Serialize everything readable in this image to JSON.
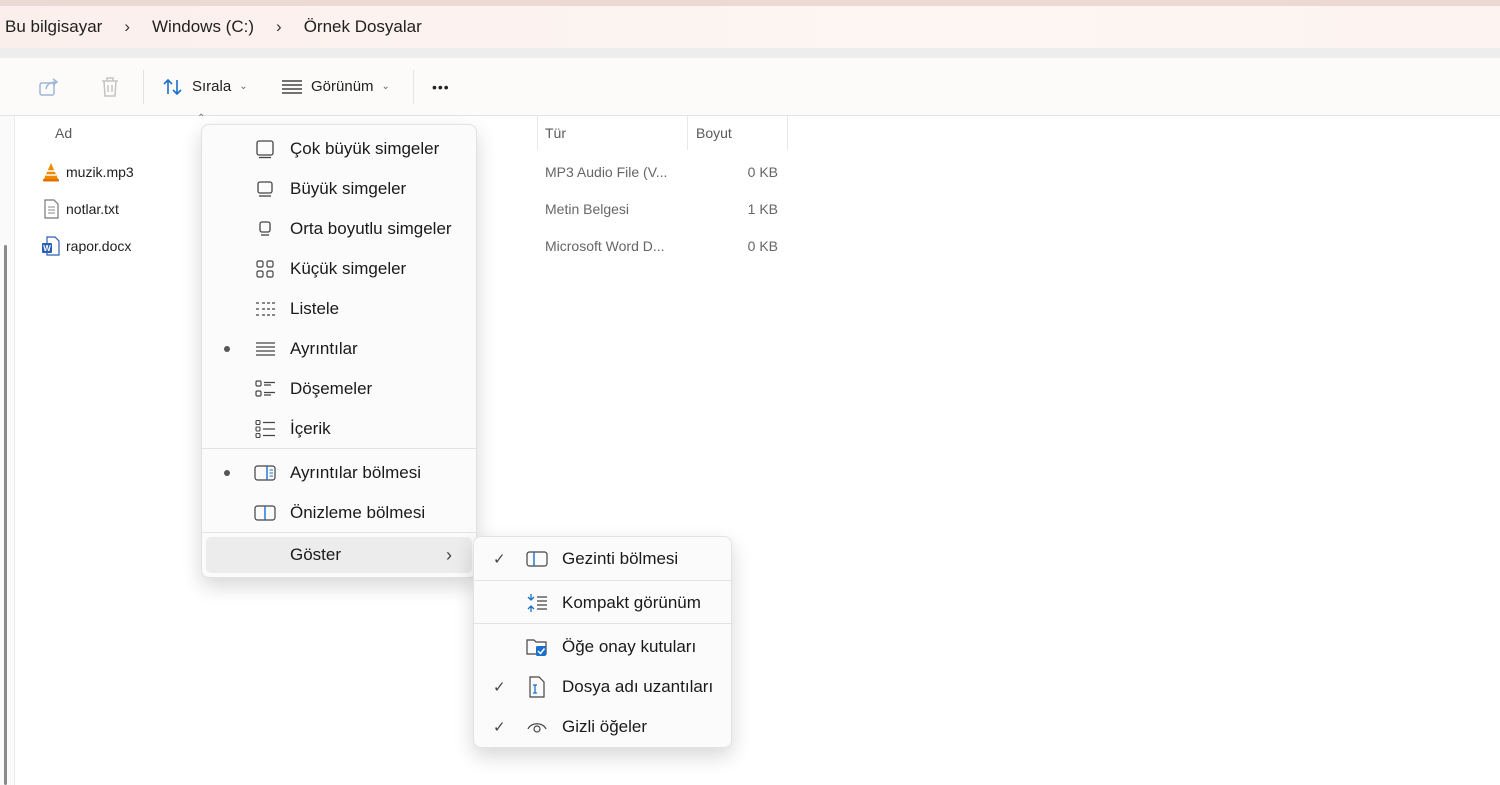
{
  "breadcrumb": [
    "Bu bilgisayar",
    "Windows (C:)",
    "Örnek Dosyalar"
  ],
  "breadcrumb_separator": "›",
  "toolbar": {
    "share_icon": "share-icon",
    "delete_icon": "trash-icon",
    "sort_label": "Sırala",
    "view_label": "Görünüm",
    "more_label": "•••"
  },
  "columns": {
    "name": "Ad",
    "type": "Tür",
    "size": "Boyut"
  },
  "files": [
    {
      "name": "muzik.mp3",
      "type": "MP3 Audio File (V...",
      "size": "0 KB",
      "icon": "vlc-icon"
    },
    {
      "name": "notlar.txt",
      "type": "Metin Belgesi",
      "size": "1 KB",
      "icon": "text-file-icon"
    },
    {
      "name": "rapor.docx",
      "type": "Microsoft Word D...",
      "size": "0 KB",
      "icon": "word-file-icon"
    }
  ],
  "view_menu": {
    "items": [
      {
        "label": "Çok büyük simgeler",
        "selected": false
      },
      {
        "label": "Büyük simgeler",
        "selected": false
      },
      {
        "label": "Orta boyutlu simgeler",
        "selected": false
      },
      {
        "label": "Küçük simgeler",
        "selected": false
      },
      {
        "label": "Listele",
        "selected": false
      },
      {
        "label": "Ayrıntılar",
        "selected": true
      },
      {
        "label": "Döşemeler",
        "selected": false
      },
      {
        "label": "İçerik",
        "selected": false
      }
    ],
    "panes": [
      {
        "label": "Ayrıntılar bölmesi",
        "selected": true
      },
      {
        "label": "Önizleme bölmesi",
        "selected": false
      }
    ],
    "show_label": "Göster",
    "show_chevron": "›"
  },
  "show_menu": {
    "items": [
      {
        "label": "Gezinti bölmesi",
        "checked": true
      },
      {
        "label": "Kompakt görünüm",
        "checked": false
      },
      {
        "label": "Öğe onay kutuları",
        "checked": false
      },
      {
        "label": "Dosya adı uzantıları",
        "checked": true
      },
      {
        "label": "Gizli öğeler",
        "checked": true
      }
    ],
    "check_glyph": "✓"
  },
  "colors": {
    "accent": "#1a6fc9",
    "vlc_orange": "#f08a00",
    "word_blue": "#2b5fb5"
  }
}
